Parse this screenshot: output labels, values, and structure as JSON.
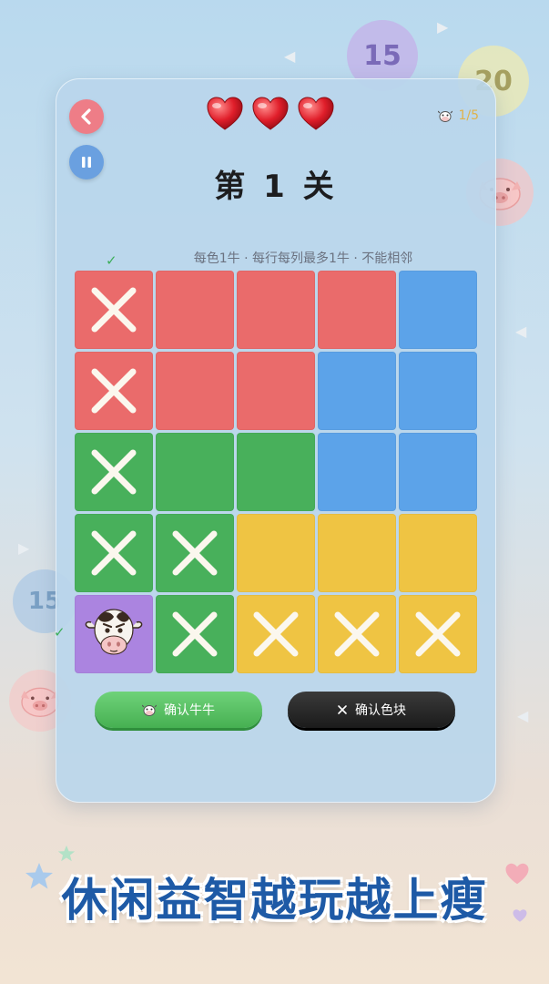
{
  "background": {
    "bubbles": [
      "15",
      "20",
      "15"
    ]
  },
  "header": {
    "back_icon": "chevron-left-icon",
    "pause_icon": "pause-icon",
    "lives": 3,
    "progress_text": "1/5",
    "title": "第 1 关",
    "rules": "每色1牛 · 每行每列最多1牛 · 不能相邻"
  },
  "board": {
    "rows": [
      [
        {
          "color": "red",
          "mark": "x"
        },
        {
          "color": "red",
          "mark": ""
        },
        {
          "color": "red",
          "mark": ""
        },
        {
          "color": "red",
          "mark": ""
        },
        {
          "color": "blue",
          "mark": ""
        }
      ],
      [
        {
          "color": "red",
          "mark": "x"
        },
        {
          "color": "red",
          "mark": ""
        },
        {
          "color": "red",
          "mark": ""
        },
        {
          "color": "blue",
          "mark": ""
        },
        {
          "color": "blue",
          "mark": ""
        }
      ],
      [
        {
          "color": "green",
          "mark": "x"
        },
        {
          "color": "green",
          "mark": ""
        },
        {
          "color": "green",
          "mark": ""
        },
        {
          "color": "blue",
          "mark": ""
        },
        {
          "color": "blue",
          "mark": ""
        }
      ],
      [
        {
          "color": "green",
          "mark": "x"
        },
        {
          "color": "green",
          "mark": "x"
        },
        {
          "color": "yellow",
          "mark": ""
        },
        {
          "color": "yellow",
          "mark": ""
        },
        {
          "color": "yellow",
          "mark": ""
        }
      ],
      [
        {
          "color": "purple",
          "mark": "cow"
        },
        {
          "color": "green",
          "mark": "x"
        },
        {
          "color": "yellow",
          "mark": "x"
        },
        {
          "color": "yellow",
          "mark": "x"
        },
        {
          "color": "yellow",
          "mark": "x"
        }
      ]
    ],
    "colors": {
      "red": "#ea6b6b",
      "blue": "#5ca3e9",
      "green": "#48b05b",
      "yellow": "#efc443",
      "purple": "#ab84e0"
    }
  },
  "actions": {
    "confirm_cow_label": "确认牛牛",
    "confirm_block_label": "确认色块",
    "confirm_block_icon": "close-icon"
  },
  "slogan": "休闲益智越玩越上瘦"
}
